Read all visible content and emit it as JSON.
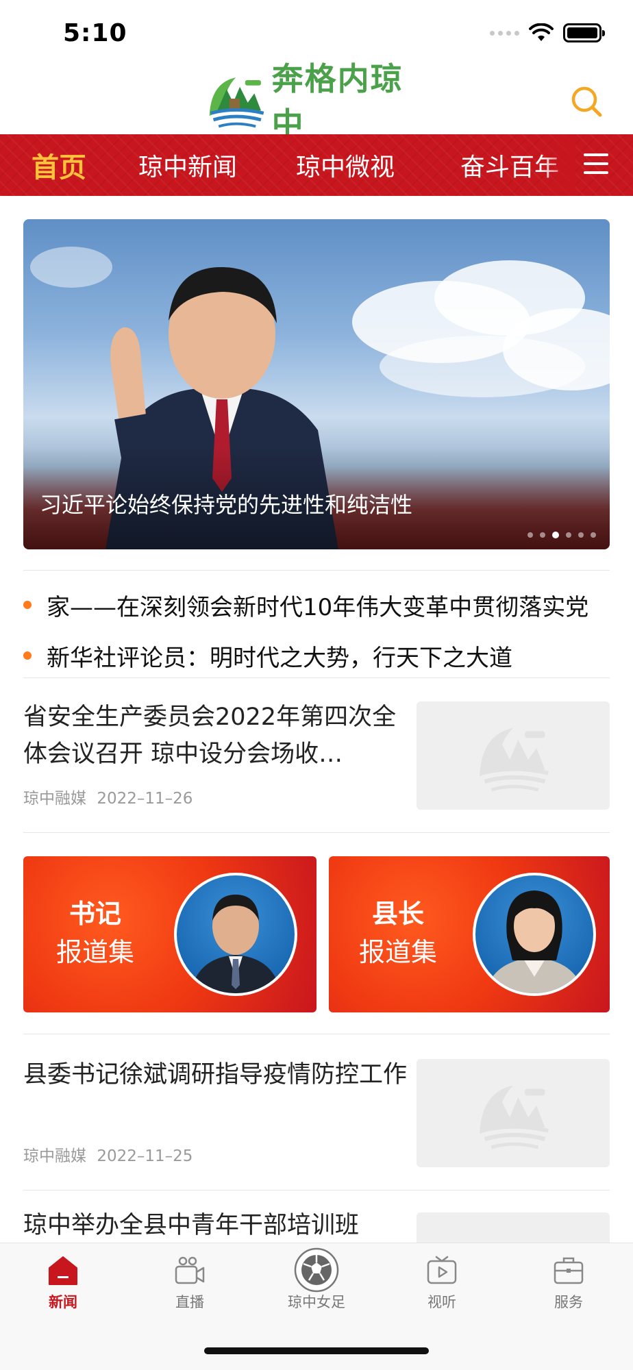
{
  "status": {
    "time": "5:10"
  },
  "header": {
    "logo_text": "奔格内琼中",
    "search_icon": "search-icon",
    "accent": "#f5a623"
  },
  "nav": {
    "tabs": [
      {
        "label": "首页",
        "active": true
      },
      {
        "label": "琼中新闻"
      },
      {
        "label": "琼中微视"
      },
      {
        "label": "奋斗百年"
      }
    ],
    "menu_icon": "hamburger-icon",
    "bg_color": "#c8161e",
    "active_color": "#ffc23a"
  },
  "banner": {
    "caption": "习近平论始终保持党的先进性和纯洁性",
    "dot_count": 6,
    "active_dot": 3
  },
  "ticker": [
    "家——在深刻领会新时代10年伟大变革中贯彻落实党",
    "新华社评论员：明时代之大势，行天下之大道"
  ],
  "news": [
    {
      "title": "省安全生产委员会2022年第四次全体会议召开 琼中设分会场收…",
      "source": "琼中融媒",
      "date": "2022–11–26"
    },
    {
      "title": "县委书记徐斌调研指导疫情防控工作",
      "source": "琼中融媒",
      "date": "2022–11–25"
    },
    {
      "title": "琼中举办全县中青年干部培训班"
    }
  ],
  "leaders": [
    {
      "line1": "书记",
      "line2": "报道集"
    },
    {
      "line1": "县长",
      "line2": "报道集"
    }
  ],
  "tabbar": {
    "items": [
      {
        "label": "新闻",
        "icon": "home-icon",
        "active": true
      },
      {
        "label": "直播",
        "icon": "camera-icon"
      },
      {
        "label": "琼中女足",
        "icon": "soccer-ball-icon"
      },
      {
        "label": "视听",
        "icon": "tv-play-icon"
      },
      {
        "label": "服务",
        "icon": "briefcase-icon"
      }
    ],
    "active_color": "#c8161e"
  }
}
